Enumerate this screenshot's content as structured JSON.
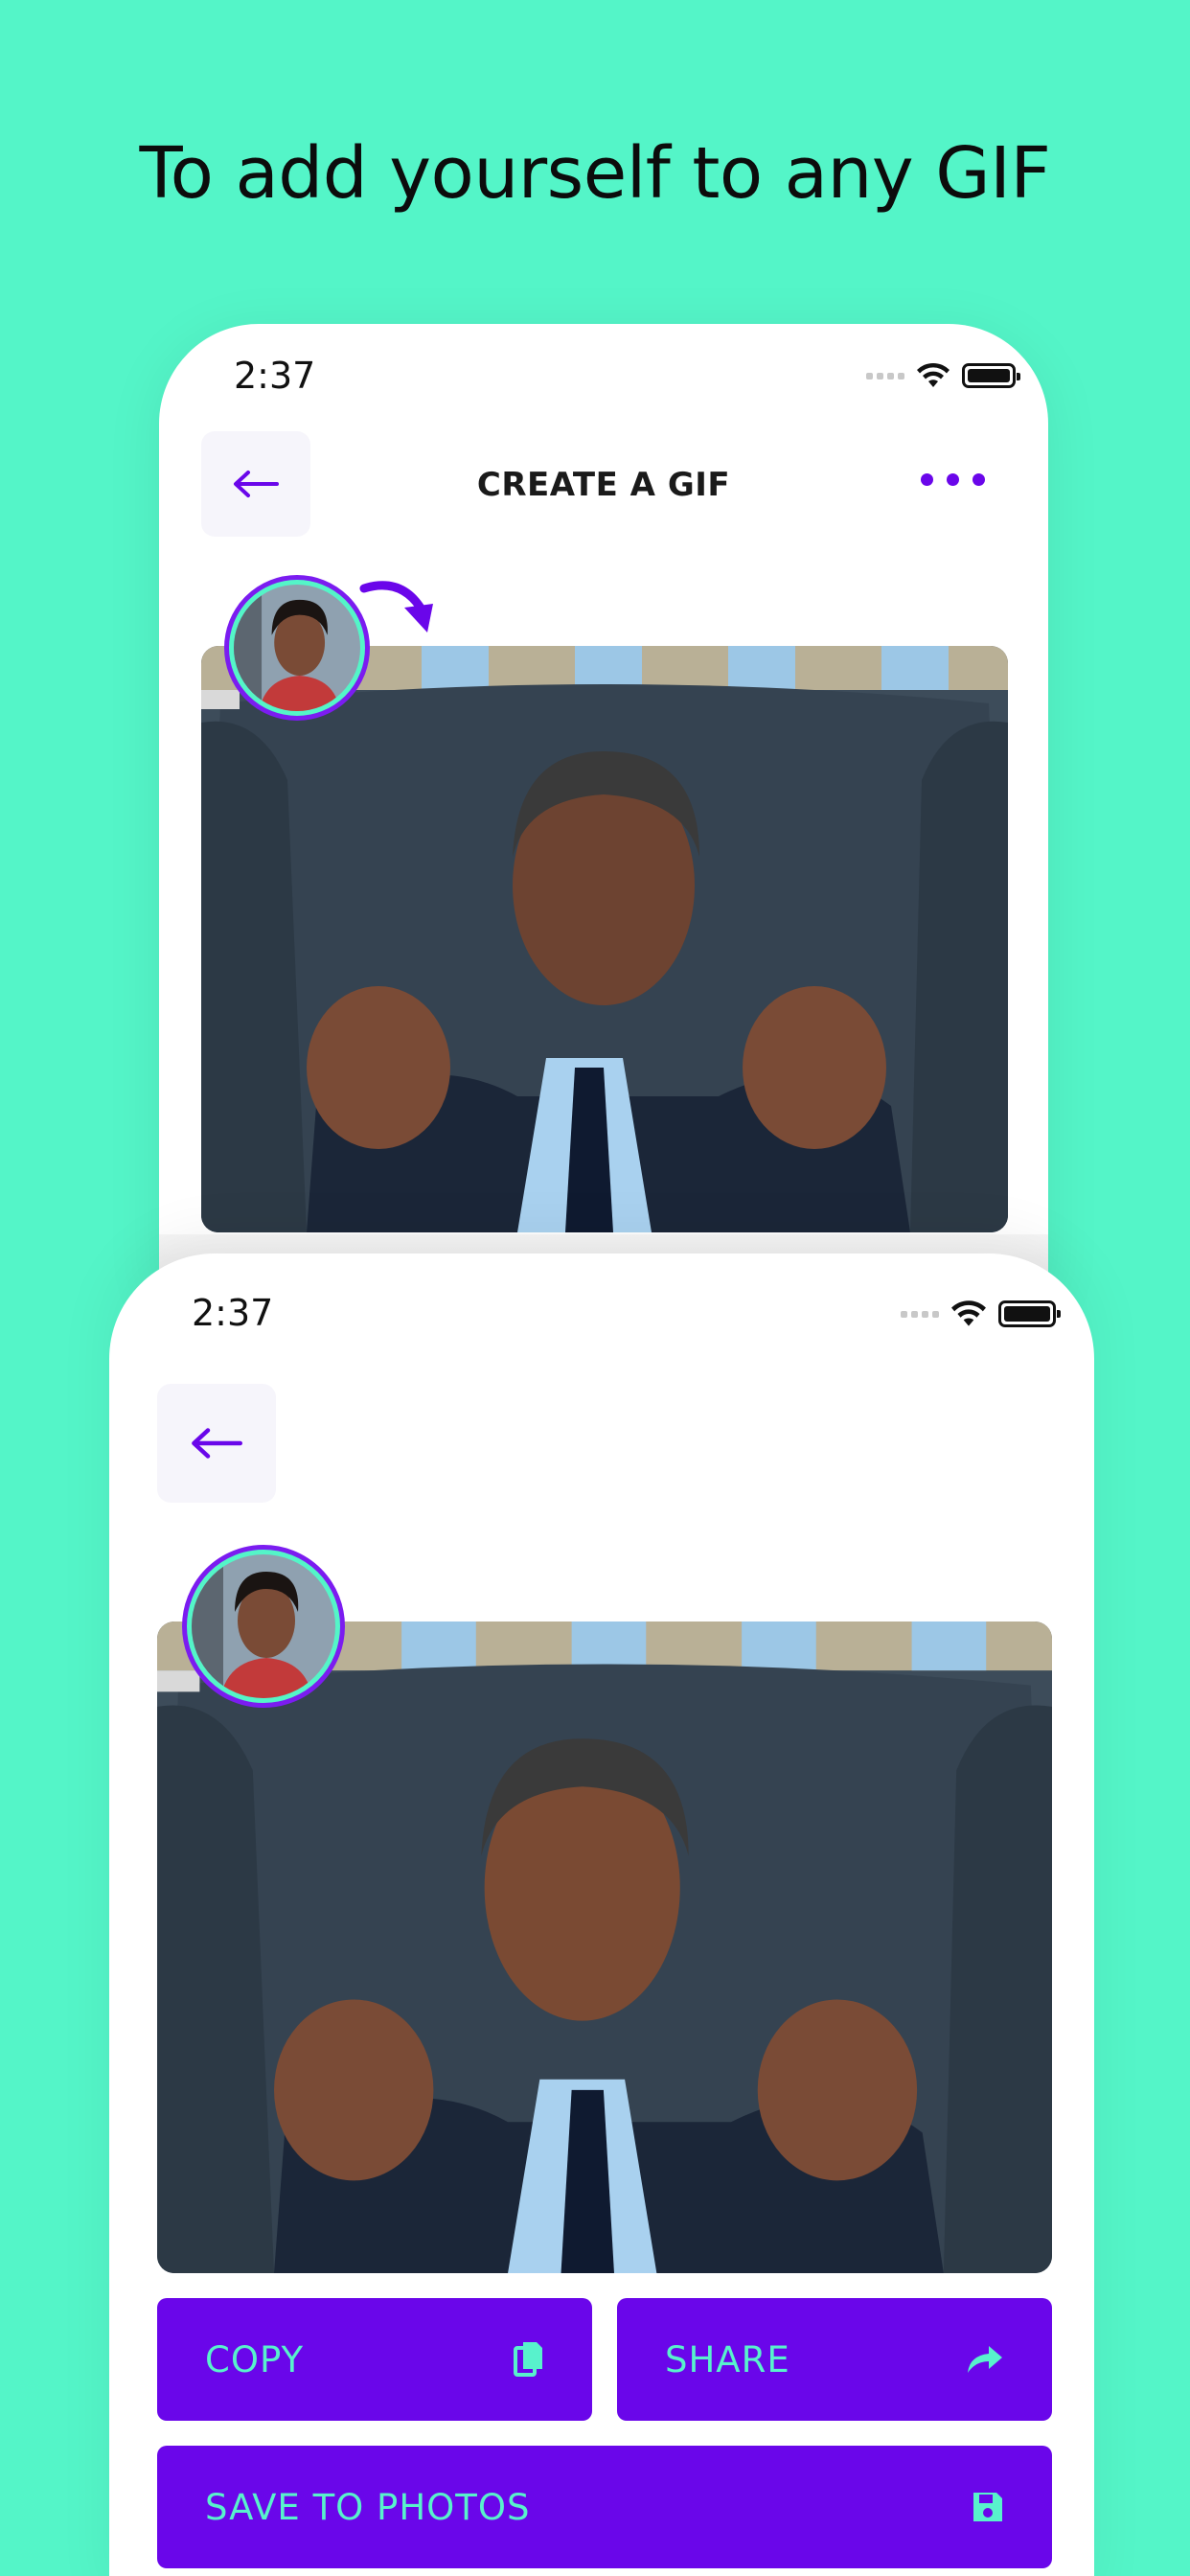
{
  "headline": "To add yourself to any GIF",
  "phone1": {
    "status_time": "2:37",
    "title": "CREATE A GIF"
  },
  "phone2": {
    "status_time": "2:37",
    "actions": {
      "copy": "COPY",
      "share": "SHARE",
      "save": "SAVE TO PHOTOS"
    }
  },
  "colors": {
    "background": "#54f5c8",
    "accent": "#6a06ea",
    "button_text": "#58f2cc"
  },
  "icons": [
    "back-arrow-icon",
    "more-dots-icon",
    "wifi-icon",
    "battery-icon",
    "signal-icon",
    "copy-icon",
    "share-icon",
    "save-icon"
  ]
}
